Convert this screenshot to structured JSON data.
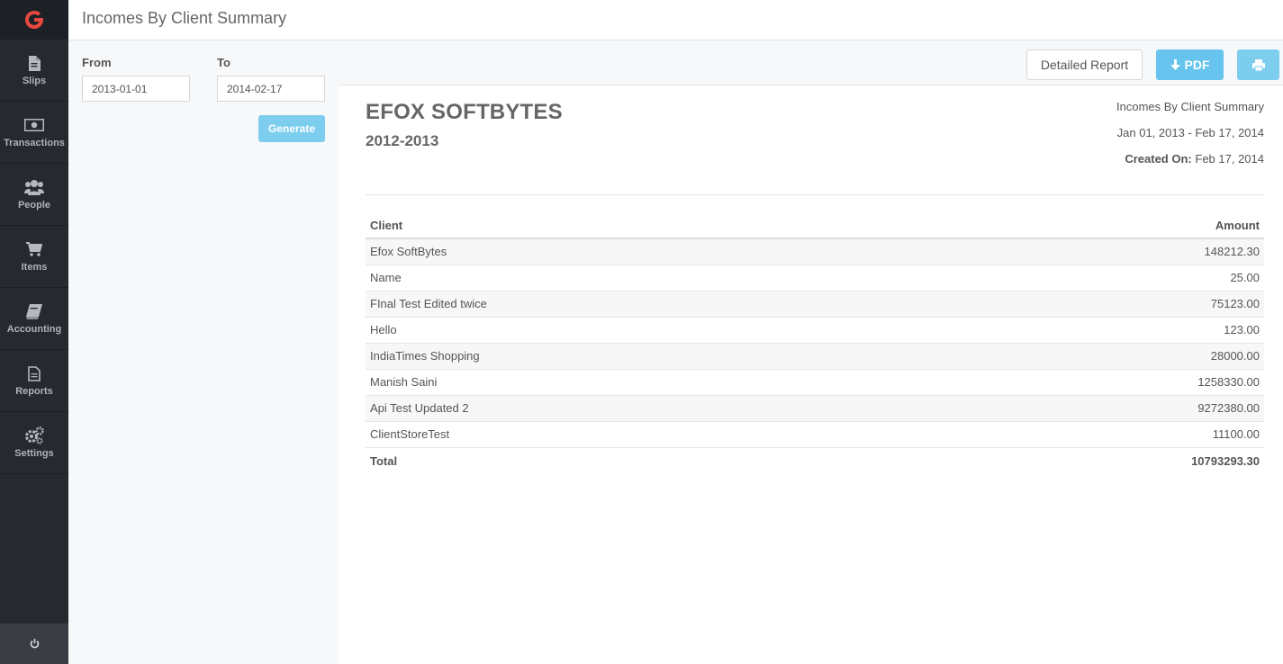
{
  "app": {
    "title": "Incomes By Client Summary"
  },
  "sidebar": {
    "logo_icon": "brand-g-logo",
    "accent_color": "#e8493f",
    "items": [
      {
        "label": "Slips",
        "icon": "file-icon"
      },
      {
        "label": "Transactions",
        "icon": "money-icon"
      },
      {
        "label": "People",
        "icon": "users-icon"
      },
      {
        "label": "Items",
        "icon": "cart-icon"
      },
      {
        "label": "Accounting",
        "icon": "book-icon"
      },
      {
        "label": "Reports",
        "icon": "report-icon"
      },
      {
        "label": "Settings",
        "icon": "gears-icon"
      }
    ],
    "power_icon": "power-icon"
  },
  "filters": {
    "from_label": "From",
    "from_value": "2013-01-01",
    "to_label": "To",
    "to_value": "2014-02-17",
    "generate_label": "Generate"
  },
  "toolbar": {
    "detailed_label": "Detailed Report",
    "pdf_label": "PDF",
    "pdf_icon": "arrow-down-icon",
    "print_icon": "print-icon"
  },
  "report": {
    "company": "EFOX SOFTBYTES",
    "fiscal_year": "2012-2013",
    "report_name": "Incomes By Client Summary",
    "date_range": "Jan 01, 2013 - Feb 17, 2014",
    "created_label": "Created On:",
    "created_value": "Feb 17, 2014",
    "columns": [
      "Client",
      "Amount"
    ],
    "rows": [
      {
        "client": "Efox SoftBytes",
        "amount": "148212.30"
      },
      {
        "client": "Name",
        "amount": "25.00"
      },
      {
        "client": "FInal Test Edited twice",
        "amount": "75123.00"
      },
      {
        "client": "Hello",
        "amount": "123.00"
      },
      {
        "client": "IndiaTimes Shopping",
        "amount": "28000.00"
      },
      {
        "client": "Manish Saini",
        "amount": "1258330.00"
      },
      {
        "client": "Api Test Updated 2",
        "amount": "9272380.00"
      },
      {
        "client": "ClientStoreTest",
        "amount": "11100.00"
      }
    ],
    "total_label": "Total",
    "total_value": "10793293.30"
  }
}
